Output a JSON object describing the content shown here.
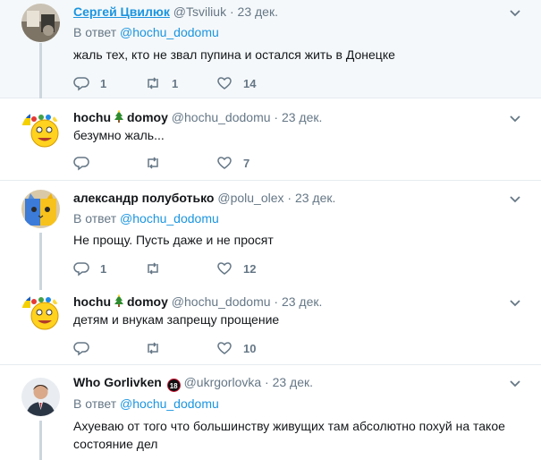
{
  "tweets": [
    {
      "fullname": "Сергей Цвилюк",
      "handle": "@Tsviliuk",
      "date": "· 23 дек.",
      "reply_label": "В ответ",
      "reply_handle": "@hochu_dodomu",
      "text": "жаль тех, кто не звал пупина и остался жить в Донецке",
      "replies": "1",
      "retweets": "1",
      "likes": "14"
    },
    {
      "fullname_part1": "hochu",
      "fullname_part2": "domoy",
      "handle": "@hochu_dodomu",
      "date": "· 23 дек.",
      "text": "безумно жаль...",
      "replies": "",
      "retweets": "",
      "likes": "7"
    },
    {
      "fullname": "александр полуботько",
      "handle": "@polu_olex",
      "date": "· 23 дек.",
      "reply_label": "В ответ",
      "reply_handle": "@hochu_dodomu",
      "text": "Не прощу. Пусть даже и не просят",
      "replies": "1",
      "retweets": "",
      "likes": "12"
    },
    {
      "fullname_part1": "hochu",
      "fullname_part2": "domoy",
      "handle": "@hochu_dodomu",
      "date": "· 23 дек.",
      "text": "детям и внукам  запрещу прощение",
      "replies": "",
      "retweets": "",
      "likes": "10"
    },
    {
      "fullname": "Who Gorlivken",
      "badge": "18",
      "handle": "@ukrgorlovka",
      "date": "· 23 дек.",
      "reply_label": "В ответ",
      "reply_handle": "@hochu_dodomu",
      "text": "Ахуеваю от того что большинству живущих там абсолютно похуй на такое состояние дел"
    }
  ],
  "icons": {
    "reply": "reply-icon",
    "retweet": "retweet-icon",
    "like": "heart-icon",
    "caret": "chevron-down-icon"
  },
  "colors": {
    "link": "#1b95e0",
    "muted": "#657786",
    "highlight_bg": "#f5f8fa",
    "thread_line": "#ccd6dd"
  }
}
